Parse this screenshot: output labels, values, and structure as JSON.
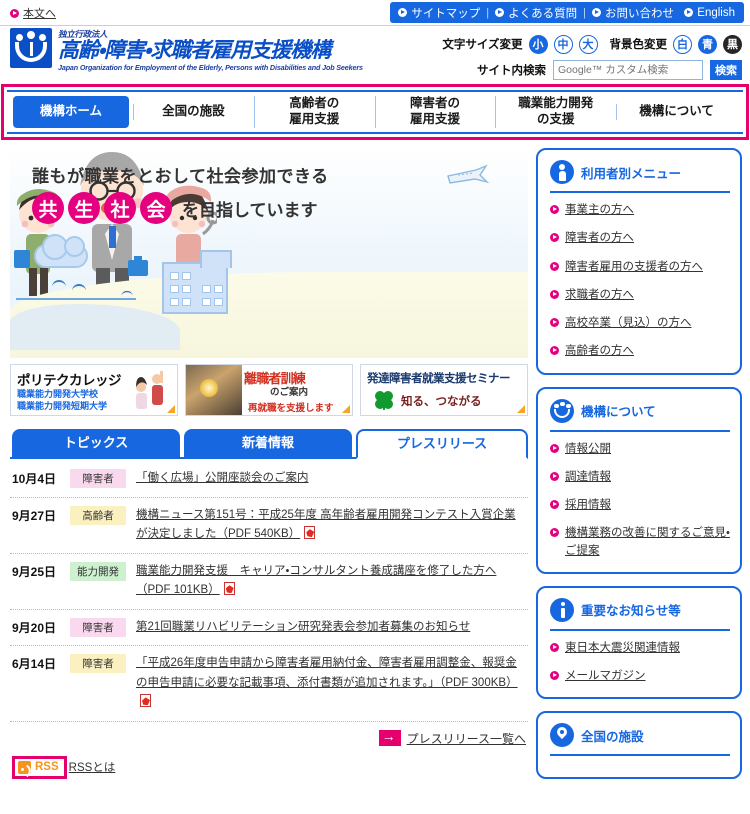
{
  "topbar": {
    "skip_link": "本文へ",
    "links": [
      "サイトマップ",
      "よくある質問",
      "お問い合わせ"
    ],
    "english": "English"
  },
  "header": {
    "logo_sub": "独立行政法人",
    "logo_main": "高齢・障害・求職者雇用支援機構",
    "logo_en": "Japan Organization for Employment of the Elderly, Persons with Disabilities and Job Seekers",
    "font_size_label": "文字サイズ変更",
    "font_sizes": [
      "小",
      "中",
      "大"
    ],
    "bg_color_label": "背景色変更",
    "bg_colors": [
      "白",
      "青",
      "黒"
    ],
    "search_label": "サイト内検索",
    "search_placeholder": "Google™ カスタム検索",
    "search_value": "",
    "search_button": "検索"
  },
  "gnav": {
    "items": [
      {
        "label": "機構ホーム",
        "active": true
      },
      {
        "label": "全国の施設",
        "line2": ""
      },
      {
        "label": "高齢者の",
        "line2": "雇用支援"
      },
      {
        "label": "障害者の",
        "line2": "雇用支援"
      },
      {
        "label": "職業能力開発",
        "line2": "の支援"
      },
      {
        "label": "機構について",
        "line2": ""
      }
    ],
    "highlight_color": "#e6006e"
  },
  "hero": {
    "line1": "誰もが職業をとおして社会参加できる",
    "pills": [
      "共",
      "生",
      "社",
      "会"
    ],
    "tail": "を目指しています",
    "pill_color": "#e4007f"
  },
  "promos": [
    {
      "title": "ポリテクカレッジ",
      "sub1": "職業能力開発大学校",
      "sub2": "職業能力開発短期大学"
    },
    {
      "title": "離職者訓練",
      "sub1": "のご案内",
      "sub2": "再就職を支援します"
    },
    {
      "title": "発達障害者就業支援セミナー",
      "sub1": "知る、つながる"
    }
  ],
  "tabs": [
    {
      "label": "トピックス",
      "active": false
    },
    {
      "label": "新着情報",
      "active": false
    },
    {
      "label": "プレスリリース",
      "active": true
    }
  ],
  "news": [
    {
      "date": "10月4日",
      "badge": "障害者",
      "badge_color": "pink",
      "title": "「働く広場」公開座談会のご案内",
      "pdf": false
    },
    {
      "date": "9月27日",
      "badge": "高齢者",
      "badge_color": "yellow",
      "title": "機構ニュース第151号：平成25年度 高年齢者雇用開発コンテスト入賞企業が決定しました（PDF 540KB）",
      "pdf": true
    },
    {
      "date": "9月25日",
      "badge": "能力開発",
      "badge_color": "green",
      "title": "職業能力開発支援　キャリア・コンサルタント養成講座を修了した方へ（PDF 101KB）",
      "pdf": true
    },
    {
      "date": "9月20日",
      "badge": "障害者",
      "badge_color": "pink",
      "title": "第21回職業リハビリテーション研究発表会参加者募集のお知らせ",
      "pdf": false
    },
    {
      "date": "6月14日",
      "badge": "障害者",
      "badge_color": "yellow",
      "title": "「平成26年度申告申請から障害者雇用納付金、障害者雇用調整金、報奨金の申告申請に必要な記載事項、添付書類が追加されます。」（PDF 300KB）",
      "pdf": true
    }
  ],
  "more_link": "プレスリリース一覧へ",
  "rss": {
    "label": "RSS",
    "what": "RSSとは",
    "highlight_color": "#e6006e"
  },
  "sidebar": [
    {
      "title": "利用者別メニュー",
      "icon": "person-icon",
      "links": [
        "事業主の方へ",
        "障害者の方へ",
        "障害者雇用の支援者の方へ",
        "求職者の方へ",
        "高校卒業（見込）の方へ",
        "高齢者の方へ"
      ]
    },
    {
      "title": "機構について",
      "icon": "organization-icon",
      "links": [
        "情報公開",
        "調達情報",
        "採用情報",
        "機構業務の改善に関するご意見・ご提案"
      ]
    },
    {
      "title": "重要なお知らせ等",
      "icon": "info-icon",
      "links": [
        "東日本大震災関連情報",
        "メールマガジン"
      ]
    },
    {
      "title": "全国の施設",
      "icon": "map-pin-icon",
      "links": []
    }
  ]
}
